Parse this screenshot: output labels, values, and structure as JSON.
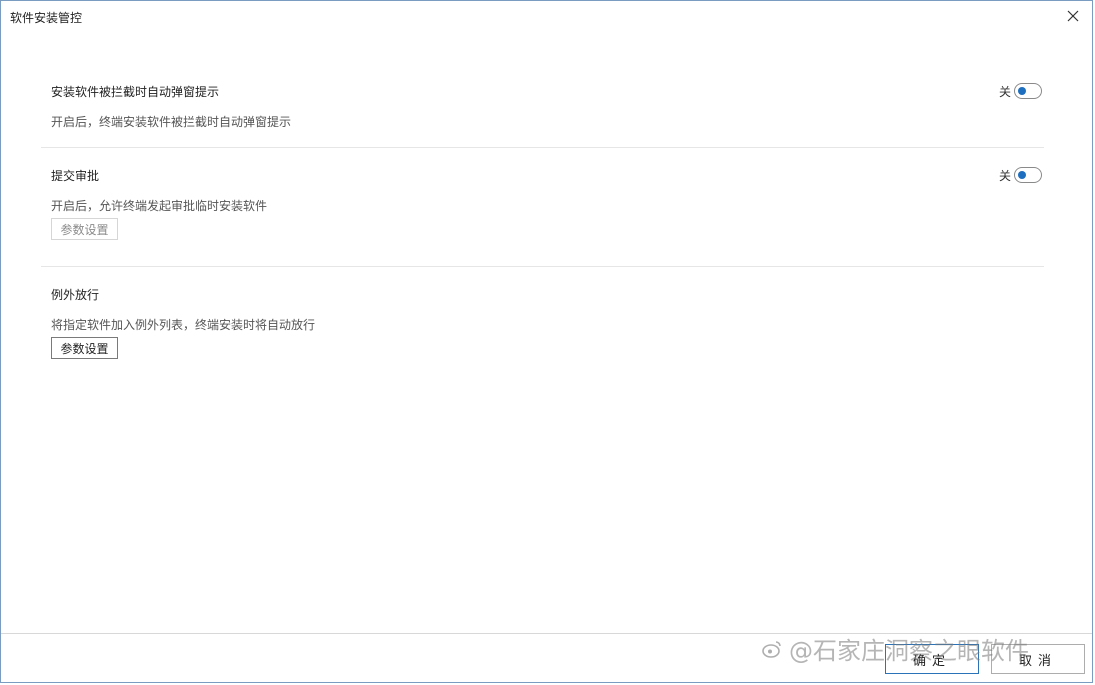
{
  "window": {
    "title": "软件安装管控"
  },
  "sections": [
    {
      "title": "安装软件被拦截时自动弹窗提示",
      "description": "开启后，终端安装软件被拦截时自动弹窗提示",
      "toggle_label": "关"
    },
    {
      "title": "提交审批",
      "description": "开启后，允许终端发起审批临时安装软件",
      "toggle_label": "关",
      "param_button_label": "参数设置"
    },
    {
      "title": "例外放行",
      "description": "将指定软件加入例外列表，终端安装时将自动放行",
      "param_button_label": "参数设置"
    }
  ],
  "footer": {
    "ok_label": "确定",
    "cancel_label": "取消"
  },
  "watermark": {
    "text": "@石家庄洞察之眼软件"
  },
  "colors": {
    "toggle_knob": "#1f6fc0",
    "window_border": "#7a9cc0",
    "ok_border": "#2b73b8"
  },
  "icons": {
    "close": "close-icon",
    "watermark": "weibo-icon"
  }
}
